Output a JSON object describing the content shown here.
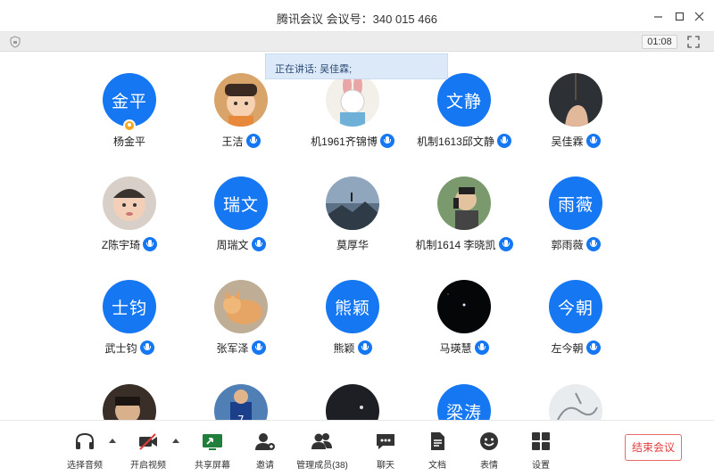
{
  "window": {
    "title": "腾讯会议 会议号：340 015 466"
  },
  "status": {
    "timer": "01:08",
    "speaking_text": "正在讲话: 吴佳霖;"
  },
  "participants": [
    {
      "name": "杨金平",
      "avatar_text": "金平",
      "avatar_type": "text",
      "mic": false,
      "host": true
    },
    {
      "name": "王洁",
      "avatar_type": "photo",
      "photo": "cartoon-child",
      "mic": true
    },
    {
      "name": "机1961齐锦博",
      "avatar_type": "photo",
      "photo": "cartoon-rabbit",
      "mic": true
    },
    {
      "name": "机制1613邱文静",
      "avatar_text": "文静",
      "avatar_type": "text",
      "mic": true
    },
    {
      "name": "吴佳霖",
      "avatar_type": "photo",
      "photo": "dark-hand",
      "mic": true
    },
    {
      "name": "Z陈宇琦",
      "avatar_type": "photo",
      "photo": "baby-face",
      "mic": true
    },
    {
      "name": "周瑞文",
      "avatar_text": "瑞文",
      "avatar_type": "text",
      "mic": true
    },
    {
      "name": "莫厚华",
      "avatar_type": "photo",
      "photo": "mountain-sky",
      "mic": false
    },
    {
      "name": "机制1614 李晓凯",
      "avatar_type": "photo",
      "photo": "person-phone",
      "mic": true
    },
    {
      "name": "郭雨薇",
      "avatar_text": "雨薇",
      "avatar_type": "text",
      "mic": true
    },
    {
      "name": "武士钧",
      "avatar_text": "士钧",
      "avatar_type": "text",
      "mic": true
    },
    {
      "name": "张军泽",
      "avatar_type": "photo",
      "photo": "cat",
      "mic": true
    },
    {
      "name": "熊颖",
      "avatar_text": "熊颖",
      "avatar_type": "text",
      "mic": true
    },
    {
      "name": "马瑛慧",
      "avatar_type": "photo",
      "photo": "night-sky",
      "mic": true
    },
    {
      "name": "左今朝",
      "avatar_text": "今朝",
      "avatar_type": "text",
      "mic": true
    },
    {
      "name": "",
      "avatar_type": "photo",
      "photo": "person-dark",
      "mic": false
    },
    {
      "name": "",
      "avatar_type": "photo",
      "photo": "football",
      "mic": false
    },
    {
      "name": "",
      "avatar_type": "photo",
      "photo": "dark-scene",
      "mic": false
    },
    {
      "name": "",
      "avatar_text": "梁涛",
      "avatar_type": "text",
      "mic": false
    },
    {
      "name": "",
      "avatar_type": "photo",
      "photo": "sketch",
      "mic": false
    }
  ],
  "toolbar": {
    "audio": "选择音频",
    "video": "开启视频",
    "share": "共享屏幕",
    "invite": "邀请",
    "members": "管理成员(38)",
    "chat": "聊天",
    "docs": "文档",
    "emoji": "表情",
    "settings": "设置",
    "end": "结束会议"
  },
  "colors": {
    "accent": "#1677f2",
    "end_button": "#e23c3c",
    "speaking_bg": "#dce9f9"
  }
}
